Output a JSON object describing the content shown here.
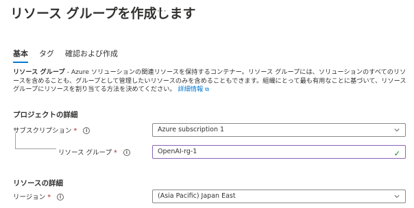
{
  "header": {
    "title": "リソース グループを作成します",
    "more": "···"
  },
  "tabs": [
    {
      "label": "基本"
    },
    {
      "label": "タグ"
    },
    {
      "label": "確認および作成"
    }
  ],
  "description": {
    "bold": "リソース グループ",
    "text": " - Azure ソリューションの関連リソースを保持するコンテナー。リソース グループには、ソリューションのすべてのリソースを含めることも、グループとして管理したいリソースのみを含めることもできます。組織にとって最も有用なことに基づいて、リソース グループにリソースを割り当てる方法を決めてください。",
    "link": "詳細情報"
  },
  "project": {
    "heading": "プロジェクトの詳細",
    "subscription": {
      "label": "サブスクリプション",
      "required": "*",
      "value": "Azure subscription 1"
    },
    "resource_group": {
      "label": "リソース グループ",
      "required": "*",
      "value": "OpenAI-rg-1"
    }
  },
  "resource": {
    "heading": "リソースの詳細",
    "region": {
      "label": "リージョン",
      "required": "*",
      "value": "(Asia Pacific) Japan East"
    }
  }
}
